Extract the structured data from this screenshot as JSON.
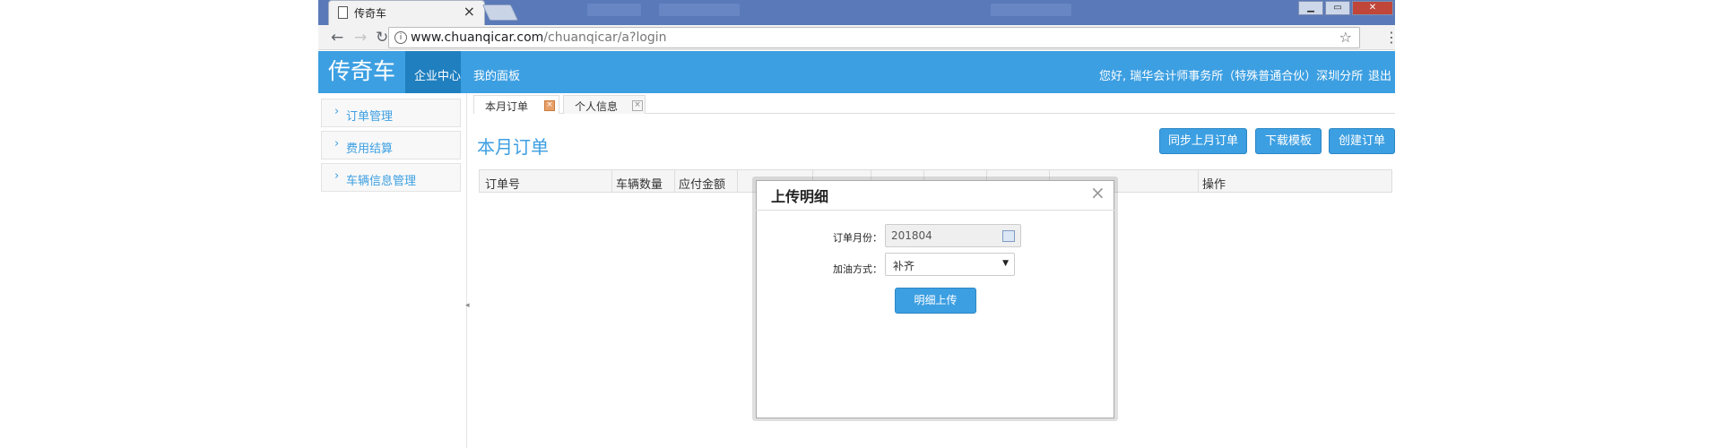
{
  "browser": {
    "tab_title": "传奇车",
    "tab_close": "×",
    "url_host": "www.chuanqicar.com",
    "url_path": "/chuanqicar/a?login",
    "window_controls": [
      "▁",
      "▭",
      "✕"
    ]
  },
  "header": {
    "logo": "传奇车",
    "nav": [
      "企业中心",
      "我的面板"
    ],
    "active_nav": "企业中心",
    "greeting": "您好, 瑞华会计师事务所（特殊普通合伙）深圳分所",
    "logout": "退出"
  },
  "sidebar": {
    "items": [
      {
        "label": "订单管理"
      },
      {
        "label": "费用结算"
      },
      {
        "label": "车辆信息管理"
      }
    ]
  },
  "content_tabs": [
    {
      "label": "本月订单",
      "active": true
    },
    {
      "label": "个人信息",
      "active": false
    }
  ],
  "page": {
    "title": "本月订单",
    "buttons": [
      "同步上月订单",
      "下载模板",
      "创建订单"
    ]
  },
  "table": {
    "columns": [
      "订单号",
      "车辆数量",
      "应付金额",
      "",
      "",
      "",
      "",
      "",
      "",
      "操作"
    ]
  },
  "modal": {
    "title": "上传明细",
    "close": "×",
    "month_label": "订单月份：",
    "month_value": "201804",
    "refuel_label": "加油方式：",
    "refuel_value": "补齐",
    "submit": "明细上传"
  },
  "colors": {
    "brand_blue": "#3c9fe2",
    "nav_active": "#1f7fbf",
    "tab_close_orange": "#e8a069"
  },
  "icons": {
    "back": "arrow-left-icon",
    "forward": "arrow-right-icon",
    "reload": "reload-icon",
    "info": "info-icon",
    "bookmark": "star-icon",
    "menu": "more-vert-icon",
    "calendar": "calendar-icon",
    "dropdown": "chevron-down-icon"
  }
}
